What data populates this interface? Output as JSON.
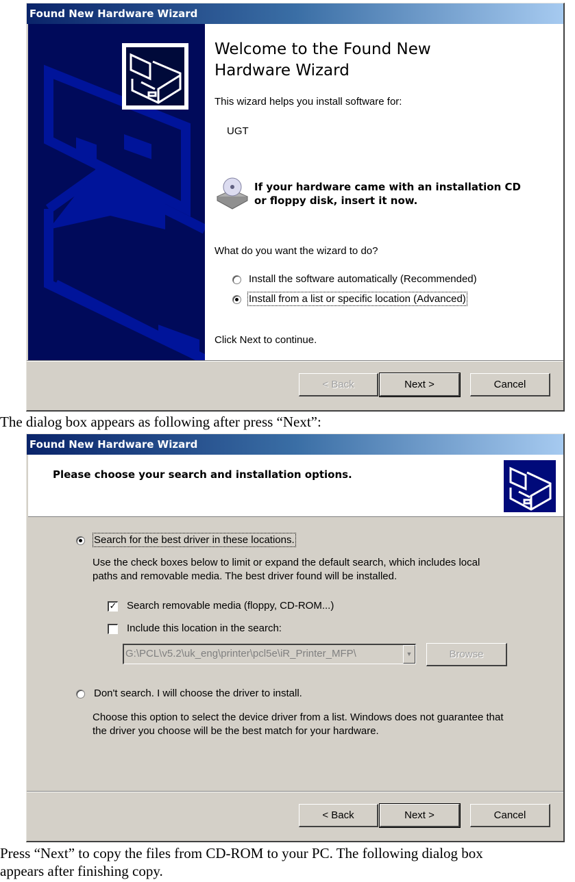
{
  "document": {
    "caption_1": "The dialog box appears as following after press “Next”:",
    "caption_2_line1": "Press “Next” to copy the files from CD-ROM to your PC. The following dialog box",
    "caption_2_line2": "appears after finishing copy."
  },
  "dialog1": {
    "title": "Found New Hardware Wizard",
    "heading_line1": "Welcome to the Found New",
    "heading_line2": "Hardware Wizard",
    "intro": "This wizard helps you install software for:",
    "device_name": "UGT",
    "cd_notice_line1": "If your hardware came with an installation CD",
    "cd_notice_line2": "or floppy disk, insert it now.",
    "question": "What do you want the wizard to do?",
    "options": [
      {
        "label": "Install the software automatically (Recommended)",
        "checked": false,
        "accel": "I"
      },
      {
        "label": "Install from a list or specific location (Advanced)",
        "checked": true,
        "accel": "s"
      }
    ],
    "footer_hint": "Click Next to continue.",
    "buttons": {
      "back": "< Back",
      "next": "Next >",
      "cancel": "Cancel"
    },
    "back_enabled": false,
    "colors": {
      "side_panel": "#000a5a",
      "titlebar_start": "#0a246a",
      "titlebar_end": "#a6caf0"
    }
  },
  "dialog2": {
    "title": "Found New Hardware Wizard",
    "header": "Please choose your search and installation options.",
    "option_search": {
      "label": "Search for the best driver in these locations.",
      "checked": true
    },
    "search_desc_line1": "Use the check boxes below to limit or expand the default search, which includes local",
    "search_desc_line2": "paths and removable media. The best driver found will be installed.",
    "checkbox_removable": {
      "label": "Search removable media (floppy, CD-ROM...)",
      "checked": true
    },
    "checkbox_location": {
      "label": "Include this location in the search:",
      "checked": false
    },
    "location_value": "G:\\PCL\\v5.2\\uk_eng\\printer\\pcl5e\\iR_Printer_MFP\\",
    "browse_label": "Browse",
    "option_dont_search": {
      "label": "Don't search. I will choose the driver to install.",
      "checked": false
    },
    "dont_desc_line1": "Choose this option to select the device driver from a list.  Windows does not guarantee that",
    "dont_desc_line2": "the driver you choose will be the best match for your hardware.",
    "buttons": {
      "back": "< Back",
      "next": "Next >",
      "cancel": "Cancel"
    }
  }
}
